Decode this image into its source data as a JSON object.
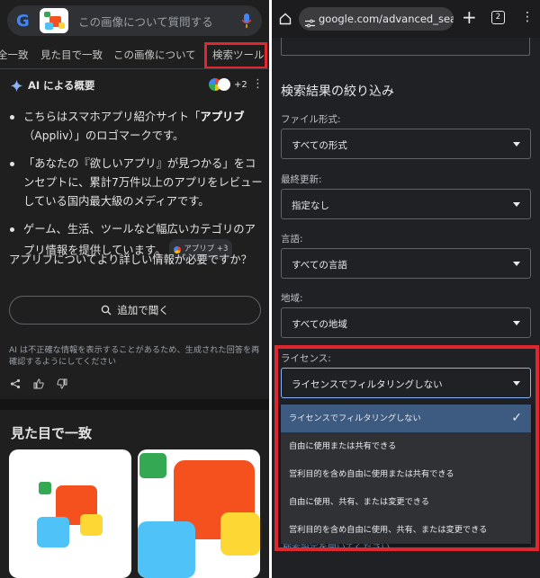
{
  "left": {
    "search": {
      "placeholder": "この画像について質問する"
    },
    "tabs": [
      "全一致",
      "見た目で一致",
      "この画像について",
      "検索ツール"
    ],
    "ai_overview": {
      "title": "AI による概要",
      "sources_more": "+2",
      "bullets": [
        {
          "pre": "こちらはスマホアプリ紹介サイト「",
          "bold": "アプリブ",
          "post": "（Appliv）」のロゴマークです。"
        },
        {
          "pre": "「あなたの『欲しいアプリ』が見つかる」をコンセプトに、累計7万件以上のアプリをレビューしている国内最大級のメディアです。",
          "bold": "",
          "post": ""
        },
        {
          "pre": "ゲーム、生活、ツールなど幅広いカテゴリのアプリ情報を提供しています。",
          "bold": "",
          "post": ""
        }
      ],
      "source_chip": "アプリブ +3",
      "question": "アプリブについてより詳しい情報が必要ですか？",
      "ask_button": "追加で聞く",
      "disclaimer": "AI は不正確な情報を表示することがあるため、生成された回答を再確認するようにしてください"
    },
    "visual_matches_title": "見た目で一致"
  },
  "right": {
    "url": "google.com/advanced_search",
    "tab_count": "2",
    "filter_title": "検索結果の絞り込み",
    "fields": [
      {
        "label": "ファイル形式:",
        "value": "すべての形式"
      },
      {
        "label": "最終更新:",
        "value": "指定なし"
      },
      {
        "label": "言語:",
        "value": "すべての言語"
      },
      {
        "label": "地域:",
        "value": "すべての地域"
      }
    ],
    "license": {
      "label": "ライセンス:",
      "value": "ライセンスでフィルタリングしない",
      "options": [
        "ライセンスでフィルタリングしない",
        "自由に使用または共有できる",
        "営利目的を含め自由に使用または共有できる",
        "自由に使用、共有、または変更できる",
        "営利目的を含め自由に使用、共有、または変更できる"
      ],
      "selected_index": 0
    },
    "behind_text": "検索設定を開いてください"
  },
  "colors": {
    "highlight": "#e0262e",
    "selected_option": "#3d5a80",
    "link": "#8ab4f8"
  }
}
